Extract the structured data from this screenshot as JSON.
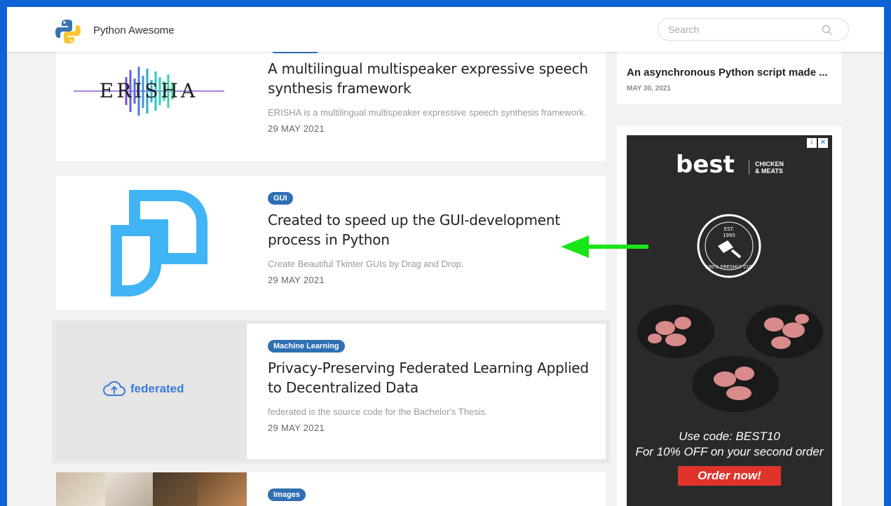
{
  "header": {
    "site_title": "Python Awesome",
    "search_placeholder": "Search",
    "logo_icon": "python-logo-icon",
    "search_icon": "search-icon"
  },
  "cards": [
    {
      "thumb_text": "ERISHA",
      "title": "A multilingual multispeaker expressive speech synthesis framework",
      "description": "ERISHA is a multilingual multispeaker expressive speech synthesis framework.",
      "date": "29 MAY 2021"
    },
    {
      "badge": "GUI",
      "title": "Created to speed up the GUI-development process in Python",
      "description": "Create Beautiful Tkinter GUIs by Drag and Drop.",
      "date": "29 MAY 2021"
    },
    {
      "badge": "Machine Learning",
      "thumb_text": "federated",
      "title": "Privacy-Preserving Federated Learning Applied to Decentralized Data",
      "description": "federated is the source code for the Bachelor's Thesis.",
      "date": "29 MAY 2021"
    },
    {
      "badge": "Images"
    }
  ],
  "sidebar": {
    "post_title": "An asynchronous Python script made ...",
    "post_date": "MAY 30, 2021"
  },
  "ad": {
    "brand": "best",
    "sub_line1": "CHICKEN",
    "sub_line2": "& MEATS",
    "seal_top": "EST.",
    "seal_year": "1995",
    "seal_text": "100% FRESHLY CUT",
    "line1": "Use code: BEST10",
    "line2": "For 10% OFF on your second order",
    "cta": "Order now!"
  },
  "colors": {
    "badge": "#2f6fb3",
    "frame_border": "#0d63d4",
    "annotation_arrow": "#19e619",
    "ad_cta": "#e0342a"
  }
}
